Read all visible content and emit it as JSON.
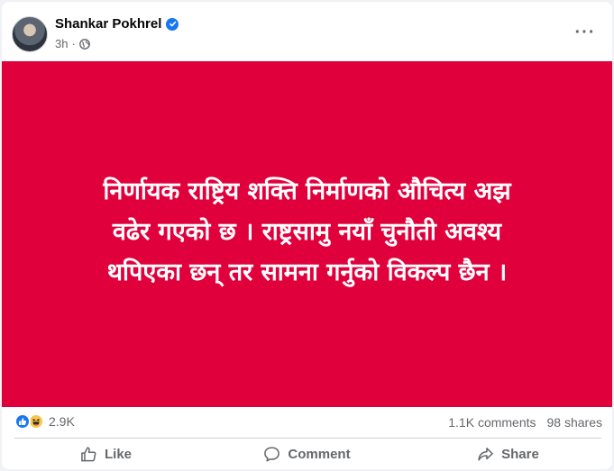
{
  "post": {
    "author": "Shankar Pokhrel",
    "timestamp": "3h",
    "separator": "·",
    "more_label": "···",
    "text_lines": [
      "निर्णायक राष्ट्रिय शक्ति निर्माणको औचित्य अझ",
      "वढेर गएको छ । राष्ट्रसामु नयाँ चुनौती अवश्य",
      "थपिएका छन् तर सामना गर्नुको विकल्प छैन ।"
    ],
    "background_color": "#e0003c"
  },
  "stats": {
    "reaction_count": "2.9K",
    "reaction_icons": [
      "like-icon",
      "haha-icon"
    ],
    "comments": "1.1K comments",
    "shares": "98 shares"
  },
  "actions": {
    "like_label": "Like",
    "comment_label": "Comment",
    "share_label": "Share"
  }
}
